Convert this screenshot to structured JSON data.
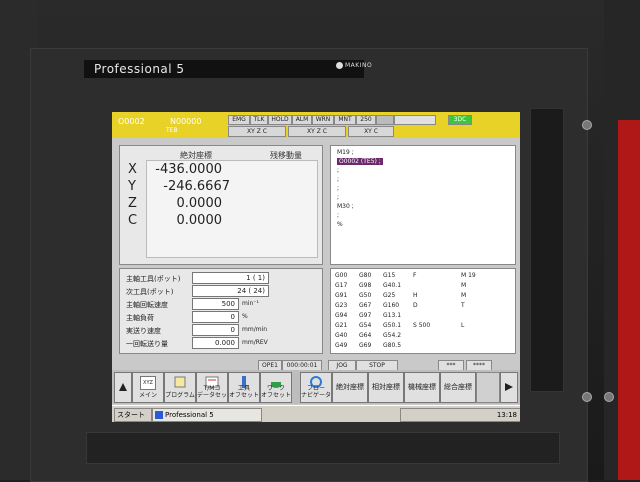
{
  "bezel": {
    "brand": "Professional 5",
    "maker": "MAKINO"
  },
  "header": {
    "prog_number": "O0002",
    "seq_number": "N00000",
    "tag": "TEB",
    "status": [
      "EMG",
      "TLK",
      "HOLD",
      "ALM",
      "WRN",
      "MNT",
      "250"
    ],
    "mode_3dc": "3DC",
    "axes_group1": "XY Z C",
    "axes_group2": "XY Z C",
    "axes_group3": "XY C"
  },
  "coords": {
    "title_abs": "絶対座標",
    "title_remain": "残移動量",
    "axes": [
      {
        "label": "X",
        "value": "-436.0000"
      },
      {
        "label": "Y",
        "value": "-246.6667"
      },
      {
        "label": "Z",
        "value": "0.0000"
      },
      {
        "label": "C",
        "value": "0.0000"
      }
    ]
  },
  "program": {
    "lines": [
      "M19 ;",
      "O0002 (TE5) ;",
      ";",
      ";",
      ";",
      ";",
      "M30 ;",
      ";",
      "%"
    ]
  },
  "info": {
    "rows": [
      {
        "label": "主軸工具(ポット)",
        "value": "1 ( 1)",
        "unit": ""
      },
      {
        "label": "次工具(ポット)",
        "value": "24 ( 24)",
        "unit": ""
      },
      {
        "label": "主軸回転速度",
        "value": "500",
        "unit": "min⁻¹"
      },
      {
        "label": "主軸負荷",
        "value": "0",
        "unit": "%"
      },
      {
        "label": "実送り速度",
        "value": "0",
        "unit": "mm/min"
      },
      {
        "label": "一回転送り量",
        "value": "0.000",
        "unit": "mm/REV"
      }
    ]
  },
  "gcodes": {
    "rows": [
      [
        "G00",
        "G80",
        "G15",
        "F",
        "M 19"
      ],
      [
        "G17",
        "G98",
        "G40.1",
        "",
        "M"
      ],
      [
        "G91",
        "G50",
        "G25",
        "H",
        "M"
      ],
      [
        "G23",
        "G67",
        "G160",
        "D",
        "T"
      ],
      [
        "G94",
        "G97",
        "G13.1",
        "",
        ""
      ],
      [
        "G21",
        "G54",
        "G50.1",
        "S 500",
        "L"
      ],
      [
        "G40",
        "G64",
        "G54.2",
        "",
        ""
      ],
      [
        "G49",
        "G69",
        "G80.5",
        "",
        ""
      ]
    ]
  },
  "modebar": {
    "ope": "OPE1",
    "time": "000:00:01",
    "mode": "JOG",
    "state": "STOP",
    "stars1": "***",
    "stars2": "****"
  },
  "softkeys": {
    "xyz_icon": "XYZ",
    "main": "メイン",
    "program": "プログラム",
    "tool_data": "T/Mコ\nデータセット",
    "tool_offset": "工具\nオフセット",
    "work_offset": "ワーク\nオフセット",
    "flow": "フロー\nナビゲータ",
    "abs_coord": "絶対座標",
    "rel_coord": "相対座標",
    "mach_coord": "機械座標",
    "total_coord": "総合座標"
  },
  "taskbar": {
    "start": "スタート",
    "task": "Professional 5",
    "time": "13:18"
  },
  "colors": {
    "header": "#e8d228",
    "highlight": "#6b2a6b",
    "accent_green": "#3cc83c"
  }
}
